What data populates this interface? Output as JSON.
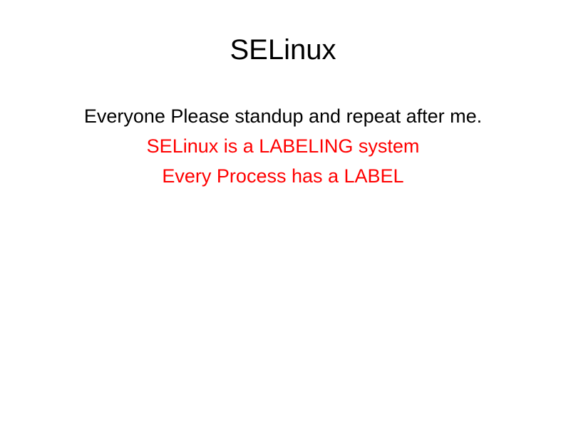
{
  "slide": {
    "title": "SELinux",
    "lines": [
      {
        "text": "Everyone Please standup and repeat after me.",
        "color": "black"
      },
      {
        "text": "SELinux is a LABELING system",
        "color": "red"
      },
      {
        "text": "Every Process has a LABEL",
        "color": "red"
      }
    ]
  }
}
